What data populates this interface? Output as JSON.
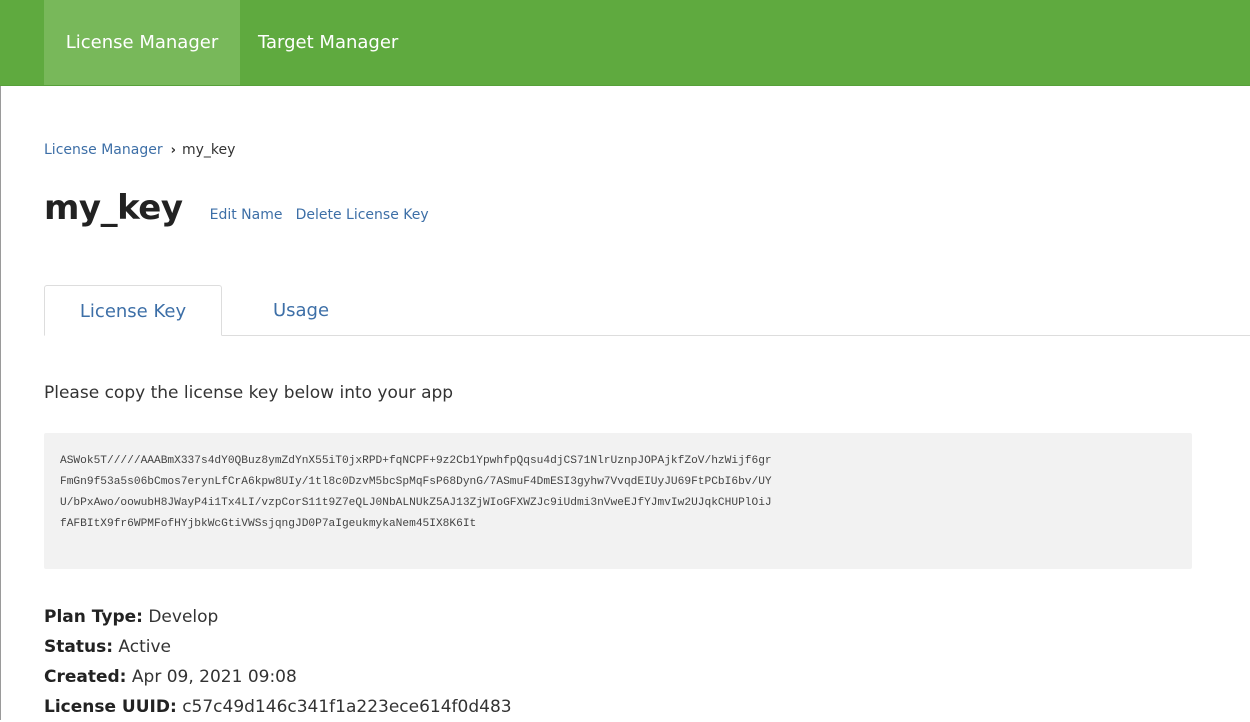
{
  "nav": {
    "items": [
      {
        "label": "License Manager"
      },
      {
        "label": "Target Manager"
      }
    ]
  },
  "breadcrumb": {
    "root": "License Manager",
    "separator": "›",
    "current": "my_key"
  },
  "header": {
    "title": "my_key",
    "edit_label": "Edit Name",
    "delete_label": "Delete License Key"
  },
  "tabs": [
    {
      "label": "License Key",
      "active": true
    },
    {
      "label": "Usage",
      "active": false
    }
  ],
  "main": {
    "instructions": "Please copy the license key below into your app",
    "license_key_lines": [
      "ASWok5T/////AAABmX337s4dY0QBuz8ymZdYnX55iT0jxRPD+fqNCPF+9z2Cb1YpwhfpQqsu4djCS71NlrUznpJOPAjkfZoV/hzWijf6gr",
      "FmGn9f53a5s06bCmos7erynLfCrA6kpw8UIy/1tl8c0DzvM5bcSpMqFsP68DynG/7ASmuF4DmESI3gyhw7VvqdEIUyJU69FtPCbI6bv/UY",
      "U/bPxAwo/oowubH8JWayP4i1Tx4LI/vzpCorS11t9Z7eQLJ0NbALNUkZ5AJ13ZjWIoGFXWZJc9iUdmi3nVweEJfYJmvIw2UJqkCHUPlOiJ",
      "fAFBItX9fr6WPMFofHYjbkWcGtiVWSsjqngJD0P7aIgeukmykaNem45IX8K6It"
    ],
    "details": [
      {
        "label": "Plan Type:",
        "value": "Develop"
      },
      {
        "label": "Status:",
        "value": "Active"
      },
      {
        "label": "Created:",
        "value": "Apr 09, 2021 09:08"
      },
      {
        "label": "License UUID:",
        "value": "c57c49d146c341f1a223ece614f0d483"
      }
    ]
  },
  "colors": {
    "topbar": "#5faa3f",
    "topbar_active": "#78b85a",
    "link": "#3d6fa7",
    "keybox_bg": "#f2f2f2"
  }
}
